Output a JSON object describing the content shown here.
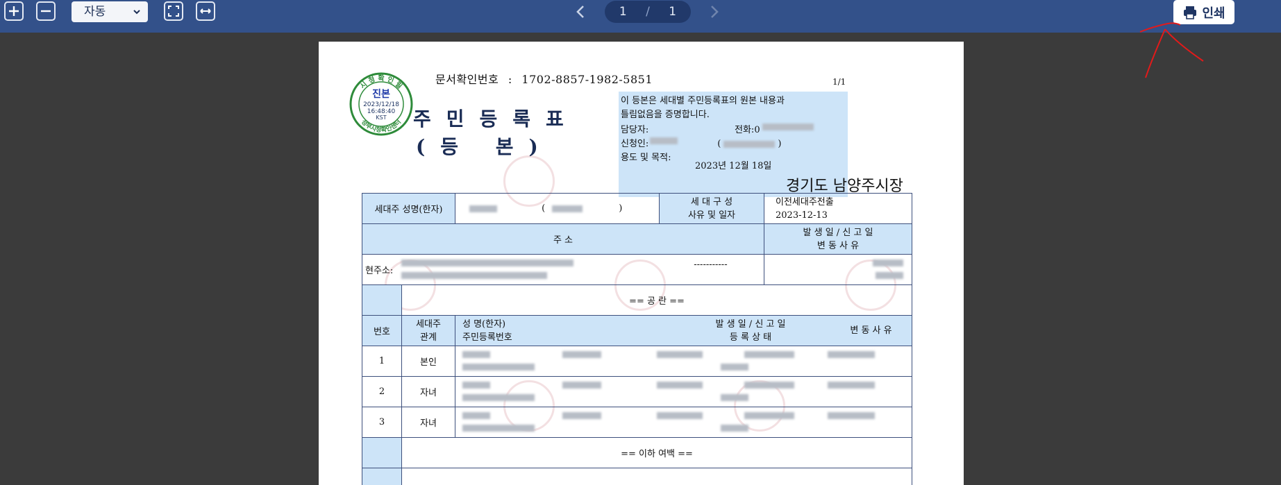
{
  "toolbar": {
    "zoom_value": "자동",
    "page_current": "1",
    "page_sep": "/",
    "page_total": "1",
    "print_label": "인쇄"
  },
  "document": {
    "doc_number_label": "문서확인번호",
    "doc_number_sep": ":",
    "doc_number": "1702-8857-1982-5851",
    "page_indicator": "1/1",
    "seal": {
      "top_text": "시 청 확 인 필",
      "center": "진본",
      "date": "2023/12/18",
      "time": "16:48:40",
      "tz": "KST",
      "bottom_text": "정부시청확인센터"
    },
    "title_line1": "주민등록표",
    "title_line2": "(등 본)",
    "info": {
      "certify_line1": "이 등본은 세대별 주민등록표의 원본 내용과",
      "certify_line2": "틀림없음을 증명합니다.",
      "manager_label": "담당자:",
      "phone_label": "전화:",
      "phone_prefix": "0",
      "applicant_label": "신청인:",
      "purpose_label": "용도 및 목적:"
    },
    "issue_date": "2023년 12월 18일",
    "issuer": "경기도 남양주시장",
    "table": {
      "head_name_label": "세대주 성명(한자)",
      "household_label_1": "세 대 구 성",
      "household_label_2": "사유 및 일자",
      "household_reason": "이전세대주전출",
      "household_date": "2023-12-13",
      "address_header": "주                     소",
      "event_header_1": "발  생  일  /  신  고  일",
      "event_header_2": "변       동       사       유",
      "current_address_label": "현주소:",
      "address_dashes": "-----------",
      "common_label": "==  공  란  ==",
      "col_no": "번호",
      "col_relation_1": "세대주",
      "col_relation_2": "관계",
      "col_name_1": "성  명(한자)",
      "col_name_2": "주민등록번호",
      "col_event_1": "발  생  일  /  신  고  일",
      "col_event_2": "등 록 상 태",
      "col_change": "변 동 사 유",
      "members": [
        {
          "no": "1",
          "relation": "본인"
        },
        {
          "no": "2",
          "relation": "자녀"
        },
        {
          "no": "3",
          "relation": "자녀"
        }
      ],
      "end_label": "== 이하 여백 =="
    }
  }
}
